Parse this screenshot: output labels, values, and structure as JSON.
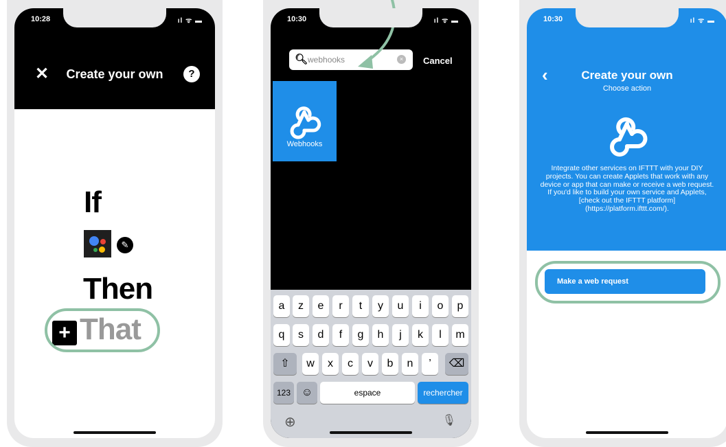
{
  "colors": {
    "accent_blue": "#1f8ee8",
    "highlight_green": "#8fc1a5",
    "header_black": "#000000",
    "that_gray": "#999999"
  },
  "screen1": {
    "status_time": "10:28",
    "status_icons": "ıl ᯤ ▬",
    "close_icon": "close-icon",
    "title": "Create your own",
    "help_label": "?",
    "if_label": "If",
    "trigger_icon": "google-assistant-icon",
    "edit_icon": "pencil-icon",
    "then_label": "Then",
    "plus_label": "+",
    "that_label": "That"
  },
  "screen2": {
    "status_time": "10:30",
    "status_icons": "ıl ᯤ ▬",
    "search_icon": "search-icon",
    "search_value": "webhooks",
    "clear_label": "×",
    "cancel_label": "Cancel",
    "result_label": "Webhooks",
    "keyboard": {
      "row1": [
        "a",
        "z",
        "e",
        "r",
        "t",
        "y",
        "u",
        "i",
        "o",
        "p"
      ],
      "row2": [
        "q",
        "s",
        "d",
        "f",
        "g",
        "h",
        "j",
        "k",
        "l",
        "m"
      ],
      "row3": [
        "w",
        "x",
        "c",
        "v",
        "b",
        "n",
        "’"
      ],
      "shift_label": "⇧",
      "delete_label": "⌫",
      "numbers_label": "123",
      "emoji_label": "☺",
      "space_label": "espace",
      "search_label": "rechercher",
      "globe_label": "⊕",
      "mic_label": "🎙"
    }
  },
  "screen3": {
    "status_time": "10:30",
    "status_icons": "ıl ᯤ ▬",
    "back_label": "‹",
    "title": "Create your own",
    "subtitle": "Choose action",
    "service_icon": "webhooks-icon",
    "description": "Integrate other services on IFTTT with your DIY projects. You can create Applets that work with any device or app that can make or receive a web request. If you'd like to build your own service and Applets, [check out the IFTTT platform] (https://platform.ifttt.com/).",
    "action_label": "Make a web request"
  }
}
